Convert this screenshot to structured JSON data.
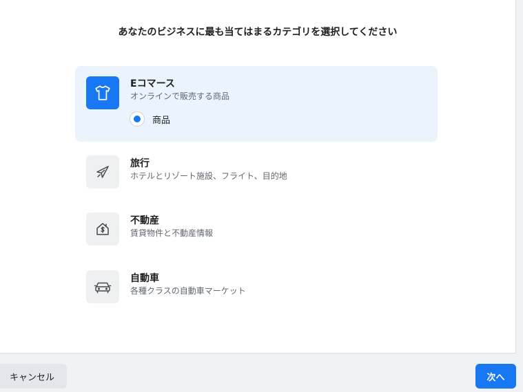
{
  "dialog": {
    "title": "あなたのビジネスに最も当てはまるカテゴリを選択してください"
  },
  "options": [
    {
      "title": "Eコマース",
      "description": "オンラインで販売する商品",
      "icon": "t-shirt-icon",
      "selected": true,
      "sub_option": {
        "label": "商品",
        "selected": true
      }
    },
    {
      "title": "旅行",
      "description": "ホテルとリゾート施設、フライト、目的地",
      "icon": "airplane-icon",
      "selected": false
    },
    {
      "title": "不動産",
      "description": "賃貸物件と不動産情報",
      "icon": "house-dollar-icon",
      "selected": false
    },
    {
      "title": "自動車",
      "description": "各種クラスの自動車マーケット",
      "icon": "car-icon",
      "selected": false
    }
  ],
  "footer": {
    "cancel_label": "キャンセル",
    "next_label": "次へ"
  },
  "colors": {
    "accent": "#1877f2",
    "selected_bg": "#ebf3fd",
    "icon_bg": "#eef0f2"
  }
}
